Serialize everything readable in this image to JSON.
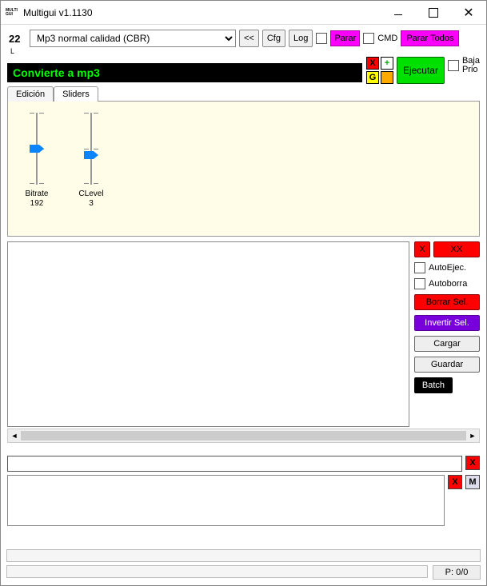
{
  "window": {
    "title": "Multigui v1.1130"
  },
  "toolbar": {
    "number": "22",
    "letter": "L",
    "preset": "Mp3 normal calidad (CBR)",
    "back": "<<",
    "cfg": "Cfg",
    "log": "Log",
    "parar": "Parar",
    "cmd": "CMD",
    "parar_todos": "Parar Todos"
  },
  "actions": {
    "x": "X",
    "plus": "+",
    "g": "G",
    "ejecutar": "Ejecutar",
    "baja1": "Baja",
    "baja2": "Prio"
  },
  "banner": "Convierte a mp3",
  "tabs": {
    "edicion": "Edición",
    "sliders": "Sliders"
  },
  "sliders": {
    "bitrate_label": "Bitrate",
    "bitrate_value": "192",
    "clevel_label": "CLevel",
    "clevel_value": "3"
  },
  "side": {
    "x": "X",
    "xx": "XX",
    "autoejec": "AutoEjec.",
    "autoborra": "Autoborra",
    "borrar": "Borrar Sel.",
    "invertir": "Invertir Sel.",
    "cargar": "Cargar",
    "guardar": "Guardar",
    "batch": "Batch"
  },
  "bottom": {
    "x": "X",
    "m": "M",
    "pcount": "P: 0/0"
  }
}
